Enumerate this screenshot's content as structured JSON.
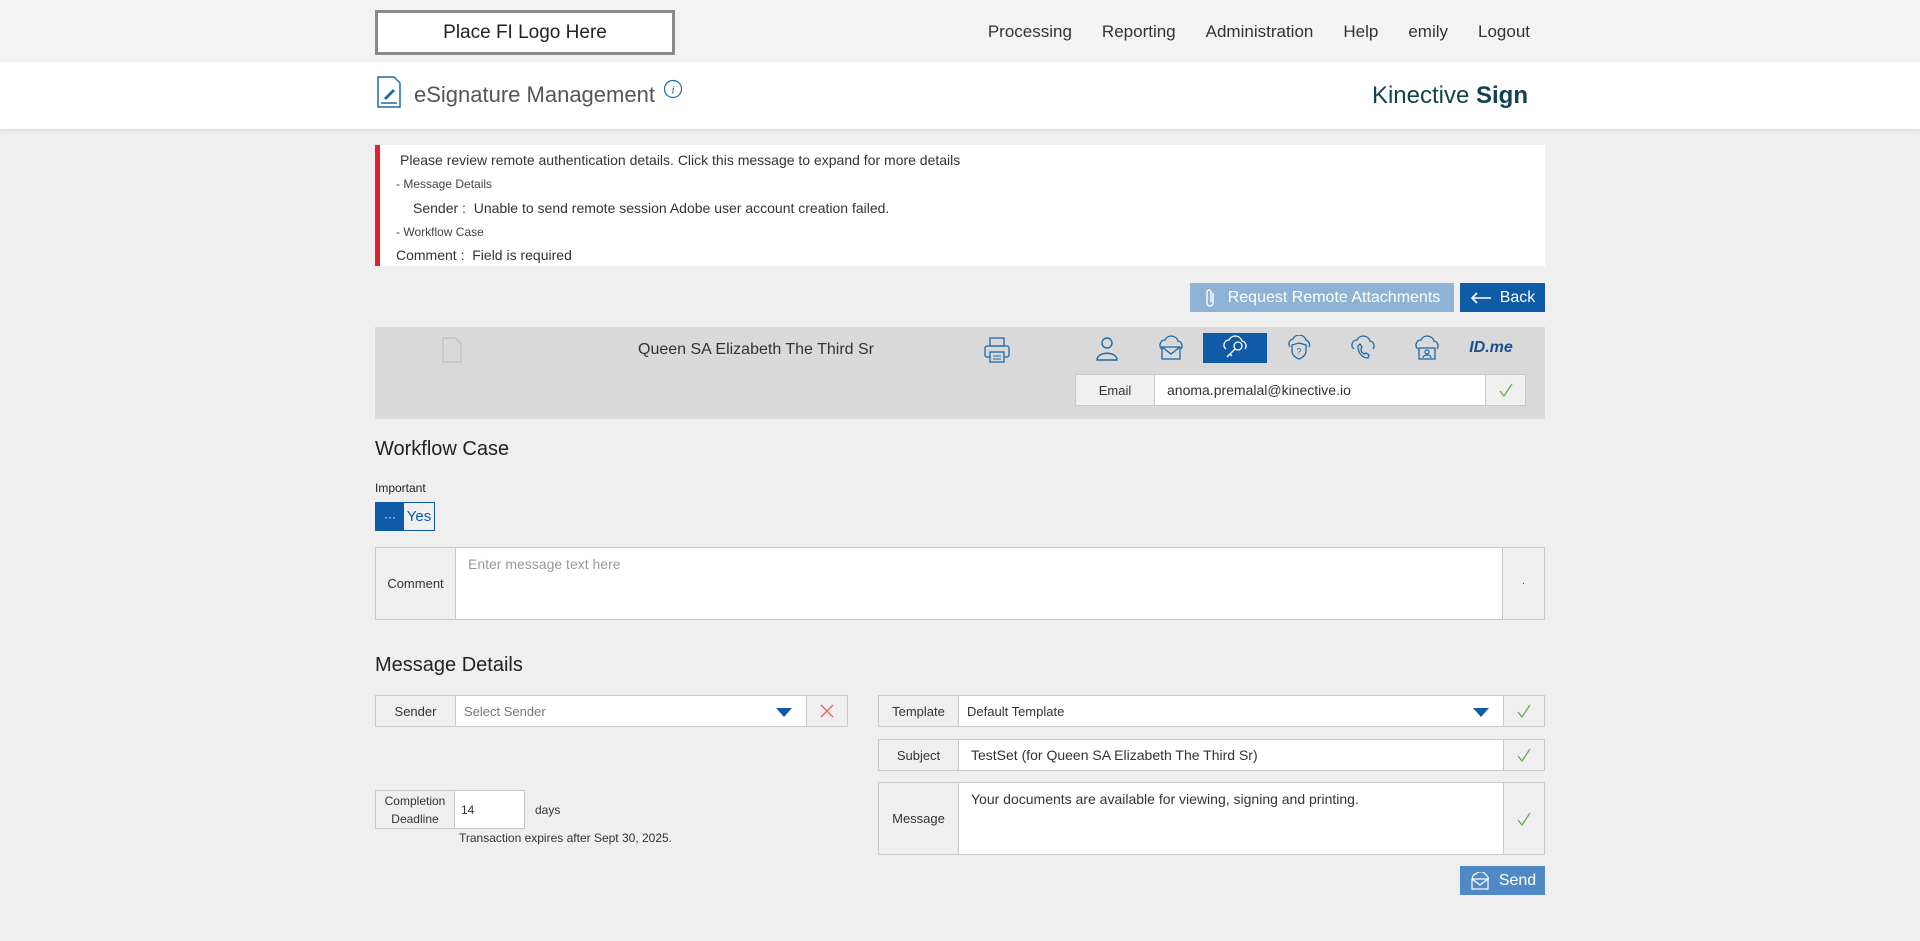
{
  "logo_placeholder": "Place FI Logo Here",
  "nav": {
    "items": [
      "Processing",
      "Reporting",
      "Administration",
      "Help",
      "emily",
      "Logout"
    ]
  },
  "header": {
    "title": "eSignature Management",
    "brand_light": "Kinective ",
    "brand_bold": "Sign"
  },
  "alert": {
    "summary": "Please review remote authentication details. Click this message to expand for more details",
    "section1": "- Message Details",
    "section1_field": "Sender :",
    "section1_msg": "Unable to send remote session Adobe user account creation failed.",
    "section2": "- Workflow Case",
    "section2_field": "Comment :",
    "section2_msg": "Field is required"
  },
  "actions": {
    "attach_label": "Request Remote Attachments",
    "back_label": "Back"
  },
  "signer": {
    "name": "Queen SA Elizabeth The Third Sr",
    "auth_icons": [
      "person-icon",
      "cloud-mail-icon",
      "cloud-key-icon",
      "shield-question-icon",
      "cloud-phone-icon",
      "cloud-id-icon",
      "idme-icon"
    ],
    "active_auth": "cloud-key-icon",
    "idme_label": "ID.me",
    "email_label": "Email",
    "email_value": "anoma.premalal@kinective.io"
  },
  "workflow": {
    "title": "Workflow Case",
    "important_label": "Important",
    "toggle_knob": "···",
    "toggle_value": "Yes",
    "comment_label": "Comment",
    "comment_placeholder": "Enter message text here",
    "comment_required_mark": "·"
  },
  "message": {
    "title": "Message Details",
    "sender_label": "Sender",
    "sender_placeholder": "Select Sender",
    "template_label": "Template",
    "template_value": "Default Template",
    "subject_label": "Subject",
    "subject_value": "TestSet (for Queen SA Elizabeth The Third Sr)",
    "message_label": "Message",
    "message_value": "Your documents are available for viewing, signing and printing.",
    "deadline_label_1": "Completion",
    "deadline_label_2": "Deadline",
    "deadline_value": "14",
    "deadline_unit": "days",
    "expires_text": "Transaction expires after Sept 30, 2025.",
    "send_label": "Send"
  },
  "colors": {
    "primary": "#0f5ba7",
    "muted_button": "#8fb3d4",
    "send_button": "#4f8ac7",
    "alert_bar": "#e4202a",
    "check_green": "#6aa84f"
  }
}
